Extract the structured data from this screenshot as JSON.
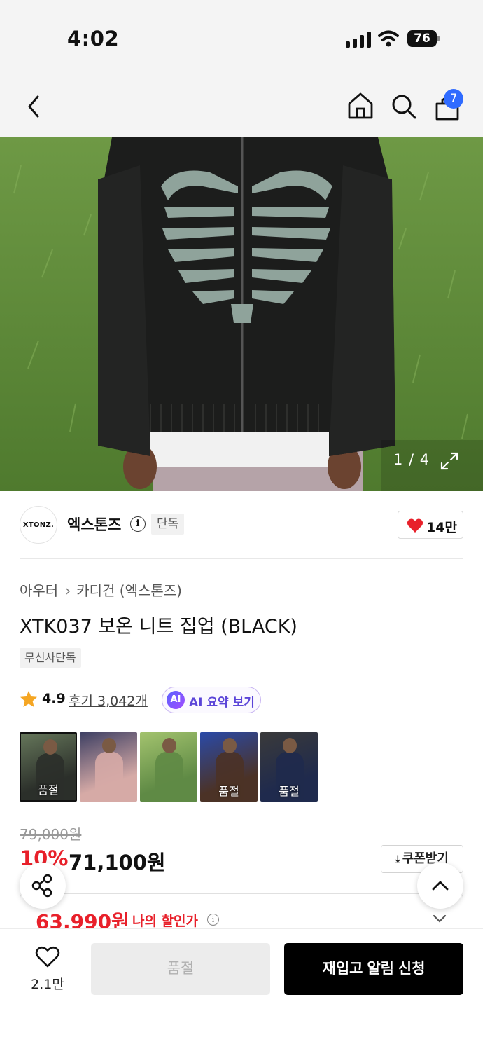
{
  "status_bar": {
    "time": "4:02",
    "battery": "76"
  },
  "nav": {
    "cart_count": "7"
  },
  "gallery": {
    "counter": "1 / 4"
  },
  "brand": {
    "logo_text": "XTONZ.",
    "name": "엑스톤즈",
    "badge": "단독",
    "like_count": "14만"
  },
  "product": {
    "category_parent": "아우터",
    "category_child": "카디건 (엑스톤즈)",
    "title": "XTK037 보온 니트 집업 (BLACK)",
    "tag": "무신사단독",
    "rating": "4.9",
    "reviews": "후기 3,042개",
    "ai_badge": "AI",
    "ai_summary": "AI 요약 보기"
  },
  "thumbnails": [
    {
      "soldout": "품절",
      "colors": [
        "#2b2f2a",
        "#65765a"
      ]
    },
    {
      "soldout": "",
      "colors": [
        "#d6aaa6",
        "#3d3f63"
      ]
    },
    {
      "soldout": "",
      "colors": [
        "#5f8a45",
        "#a3c36e"
      ]
    },
    {
      "soldout": "품절",
      "colors": [
        "#4b3226",
        "#2a4aa8"
      ]
    },
    {
      "soldout": "품절",
      "colors": [
        "#1f2a4d",
        "#3a3a3a"
      ]
    }
  ],
  "price": {
    "original": "79,000원",
    "discount_rate": "10%",
    "sale": "71,100원",
    "coupon": "쿠폰받기",
    "my_price": "63,990원",
    "my_price_label": "나의 할인가"
  },
  "bottom_bar": {
    "wish_count": "2.1만",
    "soldout": "품절",
    "restock": "재입고 알림 신청"
  },
  "colors": {
    "accent_red": "#e8202a",
    "badge_blue": "#2f6bff",
    "ai_purple": "#5b45d8"
  }
}
